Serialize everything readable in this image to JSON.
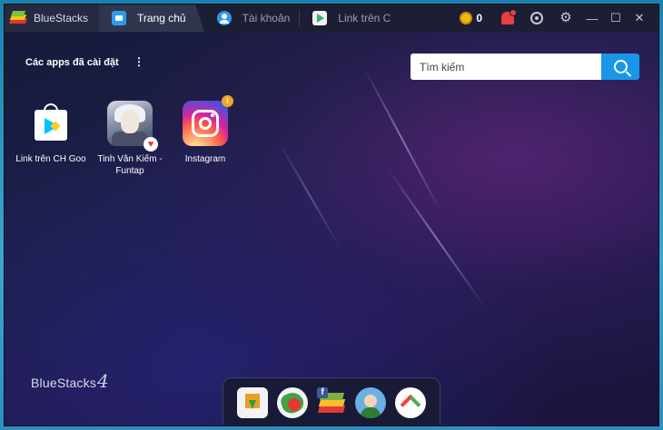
{
  "app": {
    "name": "BlueStacks"
  },
  "tabs": [
    {
      "label": "Trang chủ",
      "icon": "home-icon",
      "active": true
    },
    {
      "label": "Tài khoản",
      "icon": "account-icon",
      "active": false
    },
    {
      "label": "Link trên C",
      "icon": "play-store-icon",
      "active": false
    }
  ],
  "titlebar": {
    "coins": "0",
    "icons": [
      "coin-icon",
      "bell-icon",
      "record-icon",
      "gear-icon",
      "minimize-icon",
      "maximize-icon",
      "close-icon"
    ]
  },
  "section": {
    "title": "Các apps đã cài đặt"
  },
  "search": {
    "placeholder": "Tìm kiếm"
  },
  "apps": [
    {
      "label": "Link trên CH Goo",
      "icon": "google-play-icon"
    },
    {
      "label": "Tinh Vân Kiếm - Funtap",
      "icon": "game-icon",
      "badge": "heart-icon"
    },
    {
      "label": "Instagram",
      "icon": "instagram-icon",
      "badge": "info-icon"
    }
  ],
  "watermark": {
    "text": "BlueStacks",
    "version": "4"
  },
  "dock": [
    "download-icon",
    "app-center-icon",
    "bluestacks-facebook-icon",
    "avatar-app-icon",
    "up-arrow-app-icon"
  ],
  "colors": {
    "titlebar": "#1c1f33",
    "active_tab": "#31364f",
    "accent": "#1a96e8",
    "coin": "#f2b813",
    "bell": "#e84040"
  }
}
